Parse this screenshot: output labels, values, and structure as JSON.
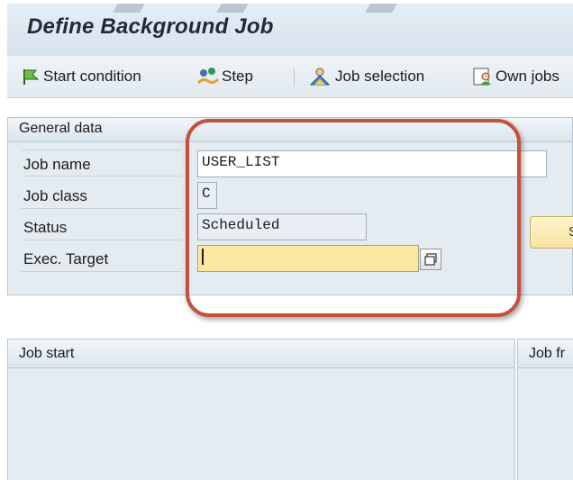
{
  "window": {
    "title": "Define Background Job"
  },
  "toolbar": {
    "items": [
      {
        "label": "Start condition",
        "icon": "start-condition-flag-icon"
      },
      {
        "label": "Step",
        "icon": "step-icon"
      },
      {
        "label": "Job selection",
        "icon": "job-selection-icon"
      },
      {
        "label": "Own jobs",
        "icon": "own-jobs-icon"
      }
    ]
  },
  "general_data": {
    "title": "General data",
    "fields": [
      {
        "label": "Job name",
        "value": "USER_LIST"
      },
      {
        "label": "Job class",
        "value": "C"
      },
      {
        "label": "Status",
        "value": "Scheduled"
      },
      {
        "label": "Exec. Target",
        "value": ""
      }
    ],
    "side_button_label": "S"
  },
  "panels": {
    "job_start": "Job start",
    "job_frequency": "Job fr"
  },
  "colors": {
    "highlight_outline": "#c4513c",
    "focused_field": "#fbe7a2",
    "panel_background": "#e4ecf2"
  }
}
